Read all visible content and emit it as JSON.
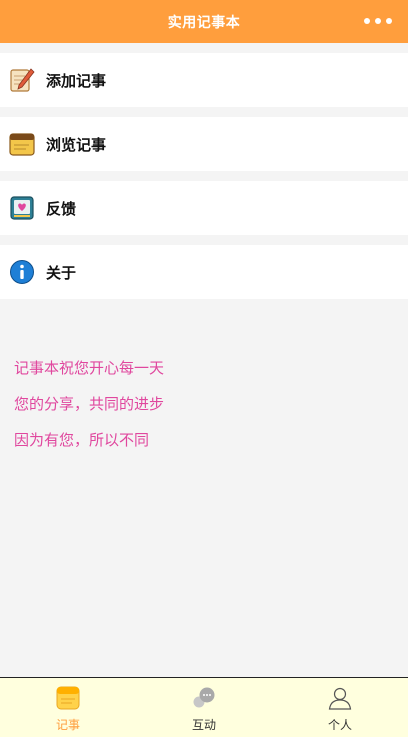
{
  "header": {
    "title": "实用记事本"
  },
  "menu": {
    "items": [
      {
        "label": "添加记事",
        "icon": "pen-paper-icon"
      },
      {
        "label": "浏览记事",
        "icon": "notepad-icon"
      },
      {
        "label": "反馈",
        "icon": "heart-book-icon"
      },
      {
        "label": "关于",
        "icon": "info-icon"
      }
    ]
  },
  "blessing": {
    "lines": [
      "记事本祝您开心每一天",
      "您的分享，共同的进步",
      "因为有您，所以不同"
    ]
  },
  "tabbar": {
    "tabs": [
      {
        "label": "记事",
        "icon": "notes-icon",
        "active": true
      },
      {
        "label": "互动",
        "icon": "chat-bubbles-icon",
        "active": false
      },
      {
        "label": "个人",
        "icon": "person-icon",
        "active": false
      }
    ]
  },
  "colors": {
    "header": "#ff9e3d",
    "accent_text": "#e0479e",
    "tabbar_bg": "#ffffde",
    "active_tab": "#ff9e3d"
  }
}
